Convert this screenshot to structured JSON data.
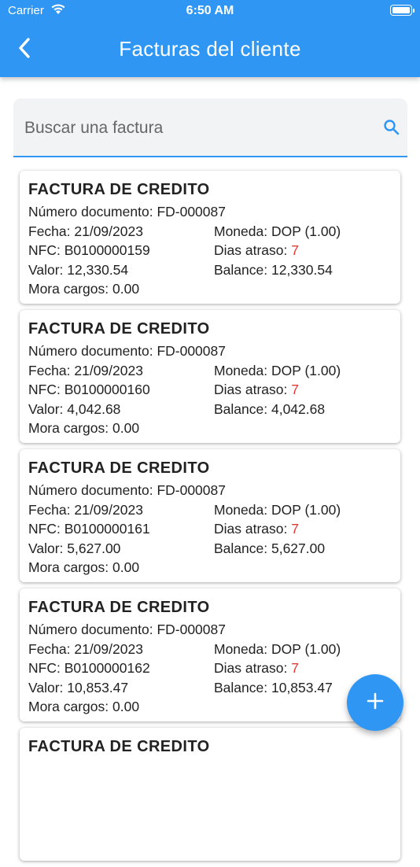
{
  "status_bar": {
    "carrier": "Carrier",
    "time": "6:50 AM"
  },
  "header": {
    "title": "Facturas del cliente"
  },
  "search": {
    "placeholder": "Buscar una factura"
  },
  "labels": {
    "documento": "Número documento:",
    "fecha": "Fecha:",
    "moneda": "Moneda:",
    "nfc": "NFC:",
    "dias": "Dias atraso:",
    "valor": "Valor:",
    "balance": "Balance:",
    "mora": "Mora cargos:"
  },
  "invoices": [
    {
      "type": "FACTURA DE CREDITO",
      "documento": "FD-000087",
      "fecha": "21/09/2023",
      "moneda": "DOP (1.00)",
      "nfc": "B0100000159",
      "dias": "7",
      "valor": "12,330.54",
      "balance": "12,330.54",
      "mora": "0.00"
    },
    {
      "type": "FACTURA DE CREDITO",
      "documento": "FD-000087",
      "fecha": "21/09/2023",
      "moneda": "DOP (1.00)",
      "nfc": "B0100000160",
      "dias": "7",
      "valor": "4,042.68",
      "balance": "4,042.68",
      "mora": "0.00"
    },
    {
      "type": "FACTURA DE CREDITO",
      "documento": "FD-000087",
      "fecha": "21/09/2023",
      "moneda": "DOP (1.00)",
      "nfc": "B0100000161",
      "dias": "7",
      "valor": "5,627.00",
      "balance": "5,627.00",
      "mora": "0.00"
    },
    {
      "type": "FACTURA DE CREDITO",
      "documento": "FD-000087",
      "fecha": "21/09/2023",
      "moneda": "DOP (1.00)",
      "nfc": "B0100000162",
      "dias": "7",
      "valor": "10,853.47",
      "balance": "10,853.47",
      "mora": "0.00"
    },
    {
      "type": "FACTURA DE CREDITO"
    }
  ],
  "colors": {
    "primary": "#2f97f3",
    "overdue": "#e53935"
  },
  "icons": {
    "back": "chevron-left-icon",
    "search": "search-icon",
    "fab": "plus-icon"
  }
}
